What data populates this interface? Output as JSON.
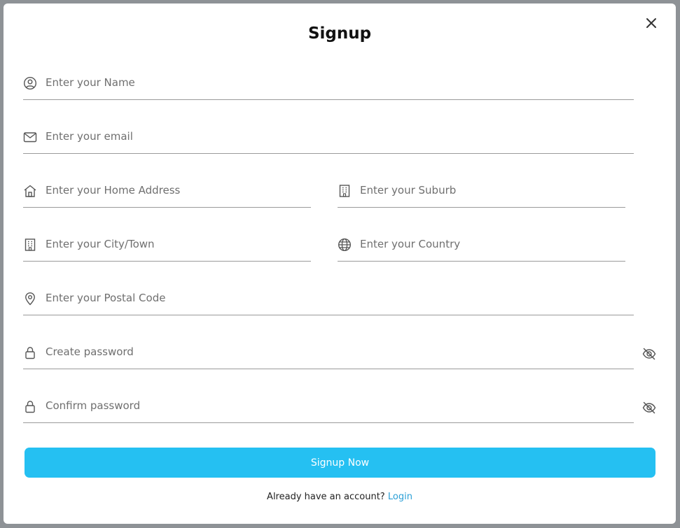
{
  "modal": {
    "title": "Signup",
    "close_icon": "close-icon"
  },
  "fields": {
    "name": {
      "placeholder": "Enter your Name",
      "icon": "user-circle-icon"
    },
    "email": {
      "placeholder": "Enter your email",
      "icon": "mail-icon"
    },
    "home_address": {
      "placeholder": "Enter your Home Address",
      "icon": "home-icon"
    },
    "suburb": {
      "placeholder": "Enter your Suburb",
      "icon": "building-icon"
    },
    "city": {
      "placeholder": "Enter your City/Town",
      "icon": "building-icon"
    },
    "country": {
      "placeholder": "Enter your Country",
      "icon": "globe-icon"
    },
    "postal_code": {
      "placeholder": "Enter your Postal Code",
      "icon": "map-pin-icon"
    },
    "password": {
      "placeholder": "Create password",
      "icon": "lock-icon",
      "toggle_icon": "eye-off-icon"
    },
    "confirm_password": {
      "placeholder": "Confirm password",
      "icon": "lock-icon",
      "toggle_icon": "eye-off-icon"
    }
  },
  "submit": {
    "label": "Signup Now"
  },
  "footer": {
    "prompt": "Already have an account?",
    "link": "Login"
  },
  "colors": {
    "accent": "#25c0f2",
    "link": "#2a9fd6",
    "underline": "#9a9a9a"
  }
}
